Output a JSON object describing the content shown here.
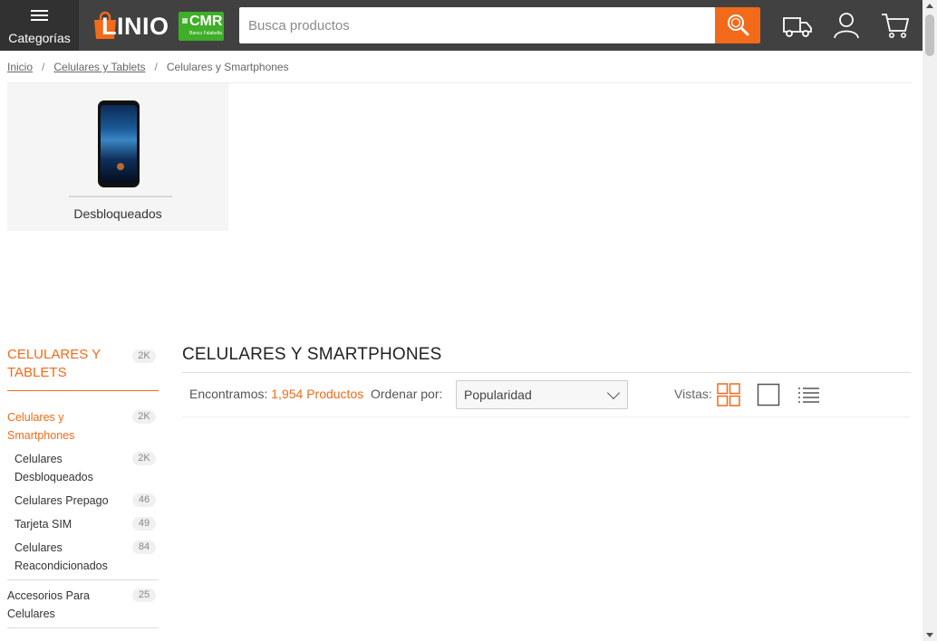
{
  "header": {
    "categories_label": "Categorías",
    "logo_text": "LINIO",
    "cmr_text": "CMR",
    "cmr_sub": "Banco Falabella",
    "search_placeholder": "Busca productos",
    "accent": "#f26a1a",
    "bg": "#414141"
  },
  "breadcrumb": {
    "items": [
      "Inicio",
      "Celulares y Tablets",
      "Celulares y Smartphones"
    ],
    "separator": "/"
  },
  "category_card": {
    "label": "Desbloqueados"
  },
  "sidebar": {
    "head_label": "CELULARES Y TABLETS",
    "head_count": "2K",
    "items": [
      {
        "label": "Celulares y Smartphones",
        "count": "2K"
      },
      {
        "label": "Celulares Desbloqueados",
        "count": "2K"
      },
      {
        "label": "Celulares Prepago",
        "count": "46"
      },
      {
        "label": "Tarjeta SIM",
        "count": "49"
      },
      {
        "label": "Celulares Reacondicionados",
        "count": "84"
      },
      {
        "label": "Accesorios Para Celulares",
        "count": "25"
      }
    ]
  },
  "main": {
    "title": "CELULARES Y SMARTPHONES",
    "found_prefix": "Encontramos:",
    "found_count": "1,954 Productos",
    "order_label": "Ordenar por:",
    "order_value": "Popularidad",
    "views_label": "Vistas:"
  }
}
